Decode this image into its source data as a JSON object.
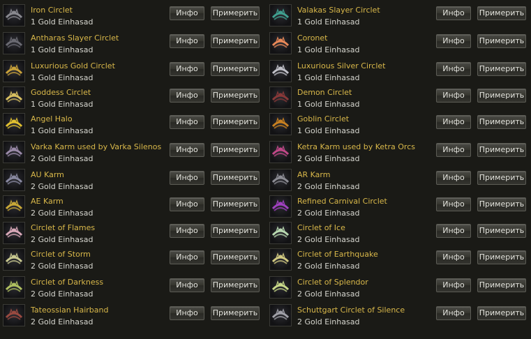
{
  "buttons": {
    "info": "Инфо",
    "try": "Примерить"
  },
  "items_left": [
    {
      "name": "Iron Circlet",
      "price": "1 Gold Einhasad",
      "icon": "iron-circlet-icon",
      "color": "#8a8a90"
    },
    {
      "name": "Antharas Slayer Circlet",
      "price": "1 Gold Einhasad",
      "icon": "antharas-slayer-circlet-icon",
      "color": "#6a6a72"
    },
    {
      "name": "Luxurious Gold Circlet",
      "price": "1 Gold Einhasad",
      "icon": "luxurious-gold-circlet-icon",
      "color": "#c9a23a"
    },
    {
      "name": "Goddess Circlet",
      "price": "1 Gold Einhasad",
      "icon": "goddess-circlet-icon",
      "color": "#d8c060"
    },
    {
      "name": "Angel Halo",
      "price": "1 Gold Einhasad",
      "icon": "angel-halo-icon",
      "color": "#e0c030"
    },
    {
      "name": "Varka Karm used by Varka Silenos",
      "price": "2 Gold Einhasad",
      "icon": "varka-karm-icon",
      "color": "#9a8aa8"
    },
    {
      "name": "AU Karm",
      "price": "2 Gold Einhasad",
      "icon": "au-karm-icon",
      "color": "#8888a0"
    },
    {
      "name": "AE Karm",
      "price": "2 Gold Einhasad",
      "icon": "ae-karm-icon",
      "color": "#c8a838"
    },
    {
      "name": "Circlet of Flames",
      "price": "2 Gold Einhasad",
      "icon": "circlet-of-flames-icon",
      "color": "#d8a8b8"
    },
    {
      "name": "Circlet of Storm",
      "price": "2 Gold Einhasad",
      "icon": "circlet-of-storm-icon",
      "color": "#c8c890"
    },
    {
      "name": "Circlet of Darkness",
      "price": "2 Gold Einhasad",
      "icon": "circlet-of-darkness-icon",
      "color": "#b0c060"
    },
    {
      "name": "Tateossian Hairband",
      "price": "2 Gold Einhasad",
      "icon": "tateossian-hairband-icon",
      "color": "#9a4a40"
    }
  ],
  "items_right": [
    {
      "name": "Valakas Slayer Circlet",
      "price": "1 Gold Einhasad",
      "icon": "valakas-slayer-circlet-icon",
      "color": "#40a090"
    },
    {
      "name": "Coronet",
      "price": "1 Gold Einhasad",
      "icon": "coronet-icon",
      "color": "#e88858"
    },
    {
      "name": "Luxurious Silver Circlet",
      "price": "1 Gold Einhasad",
      "icon": "luxurious-silver-circlet-icon",
      "color": "#c0c0c8"
    },
    {
      "name": "Demon Circlet",
      "price": "1 Gold Einhasad",
      "icon": "demon-circlet-icon",
      "color": "#883838"
    },
    {
      "name": "Goblin Circlet",
      "price": "1 Gold Einhasad",
      "icon": "goblin-circlet-icon",
      "color": "#c88020"
    },
    {
      "name": "Ketra Karm used by Ketra Orcs",
      "price": "2 Gold Einhasad",
      "icon": "ketra-karm-icon",
      "color": "#c04888"
    },
    {
      "name": "AR Karm",
      "price": "2 Gold Einhasad",
      "icon": "ar-karm-icon",
      "color": "#8c8c94"
    },
    {
      "name": "Refined Carnival Circlet",
      "price": "2 Gold Einhasad",
      "icon": "refined-carnival-circlet-icon",
      "color": "#a040c0"
    },
    {
      "name": "Circlet of Ice",
      "price": "2 Gold Einhasad",
      "icon": "circlet-of-ice-icon",
      "color": "#b8d8b0"
    },
    {
      "name": "Circlet of Earthquake",
      "price": "2 Gold Einhasad",
      "icon": "circlet-of-earthquake-icon",
      "color": "#d0c880"
    },
    {
      "name": "Circlet of Splendor",
      "price": "2 Gold Einhasad",
      "icon": "circlet-of-splendor-icon",
      "color": "#c8d888"
    },
    {
      "name": "Schuttgart Circlet of Silence",
      "price": "2 Gold Einhasad",
      "icon": "schuttgart-circlet-icon",
      "color": "#a0a0a8"
    }
  ]
}
